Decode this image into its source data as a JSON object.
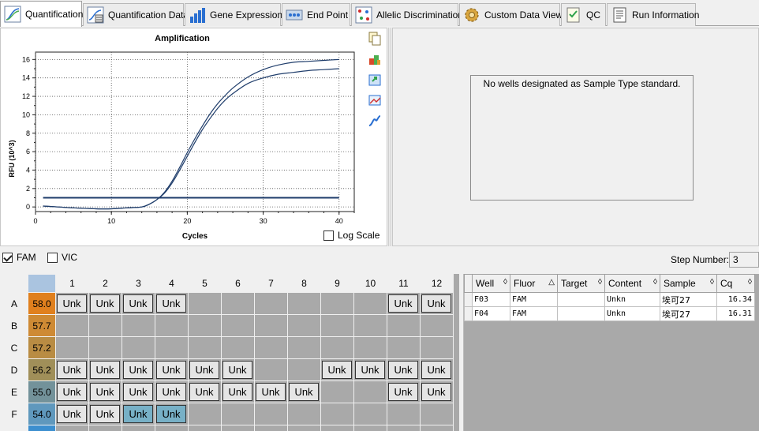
{
  "tabs": [
    {
      "label": "Quantification",
      "icon": "amplification-curve-icon",
      "active": true
    },
    {
      "label": "Quantification Data",
      "icon": "quantification-data-icon",
      "active": false
    },
    {
      "label": "Gene Expression",
      "icon": "bar-chart-icon",
      "active": false
    },
    {
      "label": "End Point",
      "icon": "end-point-icon",
      "active": false
    },
    {
      "label": "Allelic Discrimination",
      "icon": "allelic-discrimination-icon",
      "active": false
    },
    {
      "label": "Custom Data View",
      "icon": "gear-icon",
      "active": false
    },
    {
      "label": "QC",
      "icon": "qc-checklist-icon",
      "active": false
    },
    {
      "label": "Run Information",
      "icon": "run-information-icon",
      "active": false
    }
  ],
  "chart_data": {
    "type": "line",
    "title": "Amplification",
    "xlabel": "Cycles",
    "ylabel": "RFU (10^3)",
    "xlim": [
      0,
      42
    ],
    "ylim": [
      -0.5,
      16.8
    ],
    "xticks": [
      0,
      10,
      20,
      30,
      40
    ],
    "yticks": [
      0,
      2,
      4,
      6,
      8,
      10,
      12,
      14,
      16
    ],
    "grid": true,
    "series": [
      {
        "color": "#1f3d6b",
        "x": [
          1,
          3,
          5,
          8,
          10,
          12,
          14,
          15,
          16,
          17,
          18,
          19,
          20,
          21,
          22,
          23,
          24,
          25,
          26,
          28,
          30,
          32,
          34,
          36,
          38,
          40
        ],
        "y": [
          0.1,
          0.0,
          -0.1,
          -0.2,
          -0.2,
          -0.1,
          0.0,
          0.3,
          0.8,
          1.6,
          2.8,
          4.3,
          5.9,
          7.4,
          8.8,
          10.1,
          11.2,
          12.1,
          12.9,
          14.1,
          14.9,
          15.4,
          15.7,
          15.8,
          15.9,
          16.0
        ]
      },
      {
        "color": "#1f3d6b",
        "x": [
          1,
          3,
          5,
          8,
          10,
          12,
          14,
          15,
          16,
          17,
          18,
          19,
          20,
          21,
          22,
          23,
          24,
          25,
          26,
          28,
          30,
          32,
          34,
          36,
          38,
          40
        ],
        "y": [
          0.1,
          0.0,
          -0.1,
          -0.2,
          -0.2,
          -0.1,
          0.0,
          0.3,
          0.8,
          1.5,
          2.6,
          4.0,
          5.5,
          7.0,
          8.4,
          9.6,
          10.7,
          11.6,
          12.3,
          13.4,
          14.0,
          14.4,
          14.6,
          14.8,
          14.9,
          15.0
        ]
      }
    ],
    "threshold": {
      "value": 1.0,
      "x": [
        1,
        40
      ],
      "color": "#1f3d6b"
    }
  },
  "chart": {
    "logscale_label": "Log Scale",
    "logscale_checked": false
  },
  "chart_tools": [
    "copy-icon",
    "color-palette-icon",
    "export-icon",
    "image-icon",
    "curve-settings-icon"
  ],
  "standard_curve": {
    "message": "No wells designated as Sample Type standard."
  },
  "fluors": [
    {
      "label": "FAM",
      "checked": true
    },
    {
      "label": "VIC",
      "checked": false
    }
  ],
  "step": {
    "label": "Step Number:",
    "value": "3"
  },
  "plate": {
    "columns": [
      "1",
      "2",
      "3",
      "4",
      "5",
      "6",
      "7",
      "8",
      "9",
      "10",
      "11",
      "12"
    ],
    "rows": [
      {
        "label": "A",
        "temp": "58.0",
        "temp_color": "#e0801e",
        "wells": [
          "Unk",
          "Unk",
          "Unk",
          "Unk",
          "",
          "",
          "",
          "",
          "",
          "",
          "Unk",
          "Unk"
        ],
        "selected": []
      },
      {
        "label": "B",
        "temp": "57.7",
        "temp_color": "#ce8a34",
        "wells": [
          "",
          "",
          "",
          "",
          "",
          "",
          "",
          "",
          "",
          "",
          "",
          ""
        ],
        "selected": []
      },
      {
        "label": "C",
        "temp": "57.2",
        "temp_color": "#b98c43",
        "wells": [
          "",
          "",
          "",
          "",
          "",
          "",
          "",
          "",
          "",
          "",
          "",
          ""
        ],
        "selected": []
      },
      {
        "label": "D",
        "temp": "56.2",
        "temp_color": "#a08f59",
        "wells": [
          "Unk",
          "Unk",
          "Unk",
          "Unk",
          "Unk",
          "Unk",
          "",
          "",
          "Unk",
          "Unk",
          "Unk",
          "Unk"
        ],
        "selected": []
      },
      {
        "label": "E",
        "temp": "55.0",
        "temp_color": "#73929a",
        "wells": [
          "Unk",
          "Unk",
          "Unk",
          "Unk",
          "Unk",
          "Unk",
          "Unk",
          "Unk",
          "",
          "",
          "Unk",
          "Unk"
        ],
        "selected": []
      },
      {
        "label": "F",
        "temp": "54.0",
        "temp_color": "#5f98bd",
        "wells": [
          "Unk",
          "Unk",
          "Unk",
          "Unk",
          "",
          "",
          "",
          "",
          "",
          "",
          "",
          ""
        ],
        "selected": [
          2,
          3
        ]
      },
      {
        "label": "",
        "temp": "",
        "temp_color": "#3c8fcf",
        "wells": [
          "",
          "",
          "",
          "",
          "",
          "",
          "",
          "",
          "",
          "",
          "",
          ""
        ],
        "selected": []
      }
    ]
  },
  "results": {
    "columns": [
      {
        "label": "Well",
        "sort": "◊"
      },
      {
        "label": "Fluor",
        "sort": "△"
      },
      {
        "label": "Target",
        "sort": "◊"
      },
      {
        "label": "Content",
        "sort": "◊"
      },
      {
        "label": "Sample",
        "sort": "◊"
      },
      {
        "label": "Cq",
        "sort": "◊"
      }
    ],
    "rows": [
      [
        "F03",
        "FAM",
        "",
        "Unkn",
        "埃可27",
        "16.34"
      ],
      [
        "F04",
        "FAM",
        "",
        "Unkn",
        "埃可27",
        "16.31"
      ]
    ]
  }
}
